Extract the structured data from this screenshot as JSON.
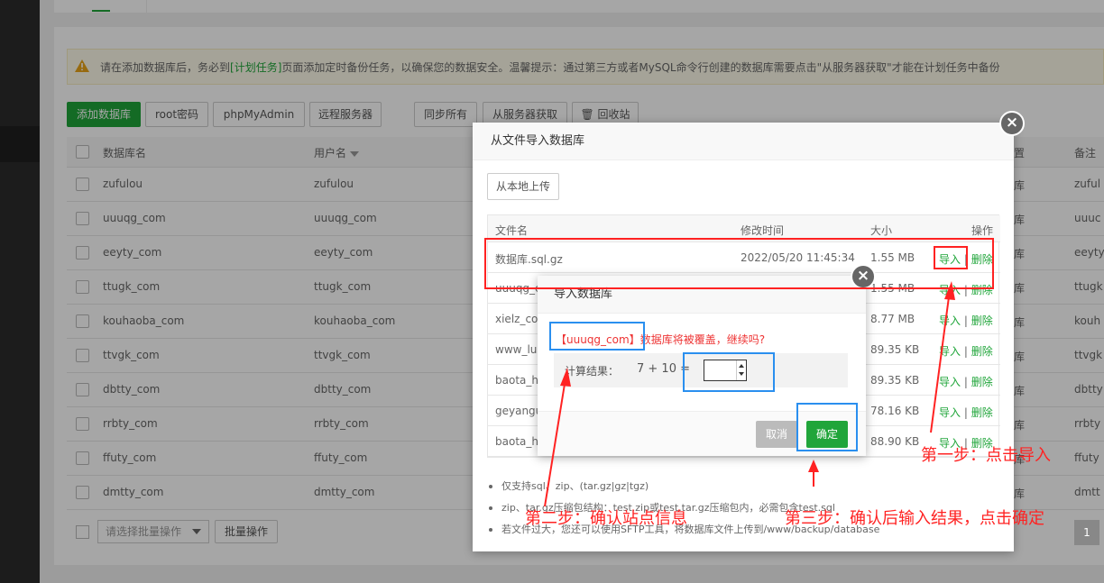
{
  "notice": {
    "text_before": "请在添加数据库后，务必到",
    "link": "[计划任务]",
    "text_after": "页面添加定时备份任务，以确保您的数据安全。温馨提示：通过第三方或者MySQL命令行创建的数据库需要点击\"从服务器获取\"才能在计划任务中备份"
  },
  "toolbar": {
    "add": "添加数据库",
    "root": "root密码",
    "pma": "phpMyAdmin",
    "remote": "远程服务器",
    "sync": "同步所有",
    "fetch": "从服务器获取",
    "recycle": "回收站"
  },
  "table": {
    "headers": {
      "name": "数据库名",
      "user": "用户名",
      "backup": "置",
      "note": "备注"
    },
    "rows": [
      {
        "name": "zufulou",
        "user": "zufulou",
        "backup": "库",
        "note": "zuful"
      },
      {
        "name": "uuuqg_com",
        "user": "uuuqg_com",
        "backup": "库",
        "note": "uuuc"
      },
      {
        "name": "eeyty_com",
        "user": "eeyty_com",
        "backup": "库",
        "note": "eeyty"
      },
      {
        "name": "ttugk_com",
        "user": "ttugk_com",
        "backup": "库",
        "note": "ttugk"
      },
      {
        "name": "kouhaoba_com",
        "user": "kouhaoba_com",
        "backup": "库",
        "note": "kouh"
      },
      {
        "name": "ttvgk_com",
        "user": "ttvgk_com",
        "backup": "库",
        "note": "ttvgk"
      },
      {
        "name": "dbtty_com",
        "user": "dbtty_com",
        "backup": "库",
        "note": "dbtty"
      },
      {
        "name": "rrbty_com",
        "user": "rrbty_com",
        "backup": "库",
        "note": "rrbty"
      },
      {
        "name": "ffuty_com",
        "user": "ffuty_com",
        "backup": "库",
        "note": "ffuty"
      },
      {
        "name": "dmtty_com",
        "user": "dmtty_com",
        "backup": "库",
        "note": "dmtt"
      }
    ]
  },
  "footer": {
    "batch_placeholder": "请选择批量操作",
    "batch_btn": "批量操作",
    "page": "1"
  },
  "import_dialog": {
    "title": "从文件导入数据库",
    "upload": "从本地上传",
    "headers": {
      "file": "文件名",
      "mtime": "修改时间",
      "size": "大小",
      "op": "操作"
    },
    "files": [
      {
        "name": "数据库.sql.gz",
        "mtime": "2022/05/20 11:45:34",
        "size": "1.55 MB"
      },
      {
        "name": "uuuqg_c",
        "mtime": "",
        "size": "1.55 MB"
      },
      {
        "name": "xielz_co",
        "mtime": "",
        "size": "8.77 MB"
      },
      {
        "name": "www_lu",
        "mtime": "",
        "size": "89.35 KB"
      },
      {
        "name": "baota_h",
        "mtime": "",
        "size": "89.35 KB"
      },
      {
        "name": "geyangu",
        "mtime": "",
        "size": "78.16 KB"
      },
      {
        "name": "baota_h",
        "mtime": "",
        "size": "88.90 KB"
      }
    ],
    "op_import": "导入",
    "op_sep": " | ",
    "op_delete": "删除",
    "tips": [
      "仅支持sql、zip、(tar.gz|gz|tgz)",
      "zip、tar.gz压缩包结构：test.zip或test.tar.gz压缩包内，必需包含test.sql",
      "若文件过大，您还可以使用SFTP工具，将数据库文件上传到/www/backup/database"
    ]
  },
  "confirm_dialog": {
    "title": "导入数据库",
    "db_name": "【uuuqg_com】",
    "message": "数据库将被覆盖，继续吗?",
    "calc_label": "计算结果：",
    "expression": "7 + 10  =",
    "answer": "",
    "cancel": "取消",
    "ok": "确定"
  },
  "annotations": {
    "step1": "第一步：点击导入",
    "step2": "第二步：确认站点信息",
    "step3": "第三步：确认后输入结果，点击确定"
  },
  "colors": {
    "green": "#20a53a",
    "red": "#ff2222",
    "blue": "#2a8fef"
  }
}
